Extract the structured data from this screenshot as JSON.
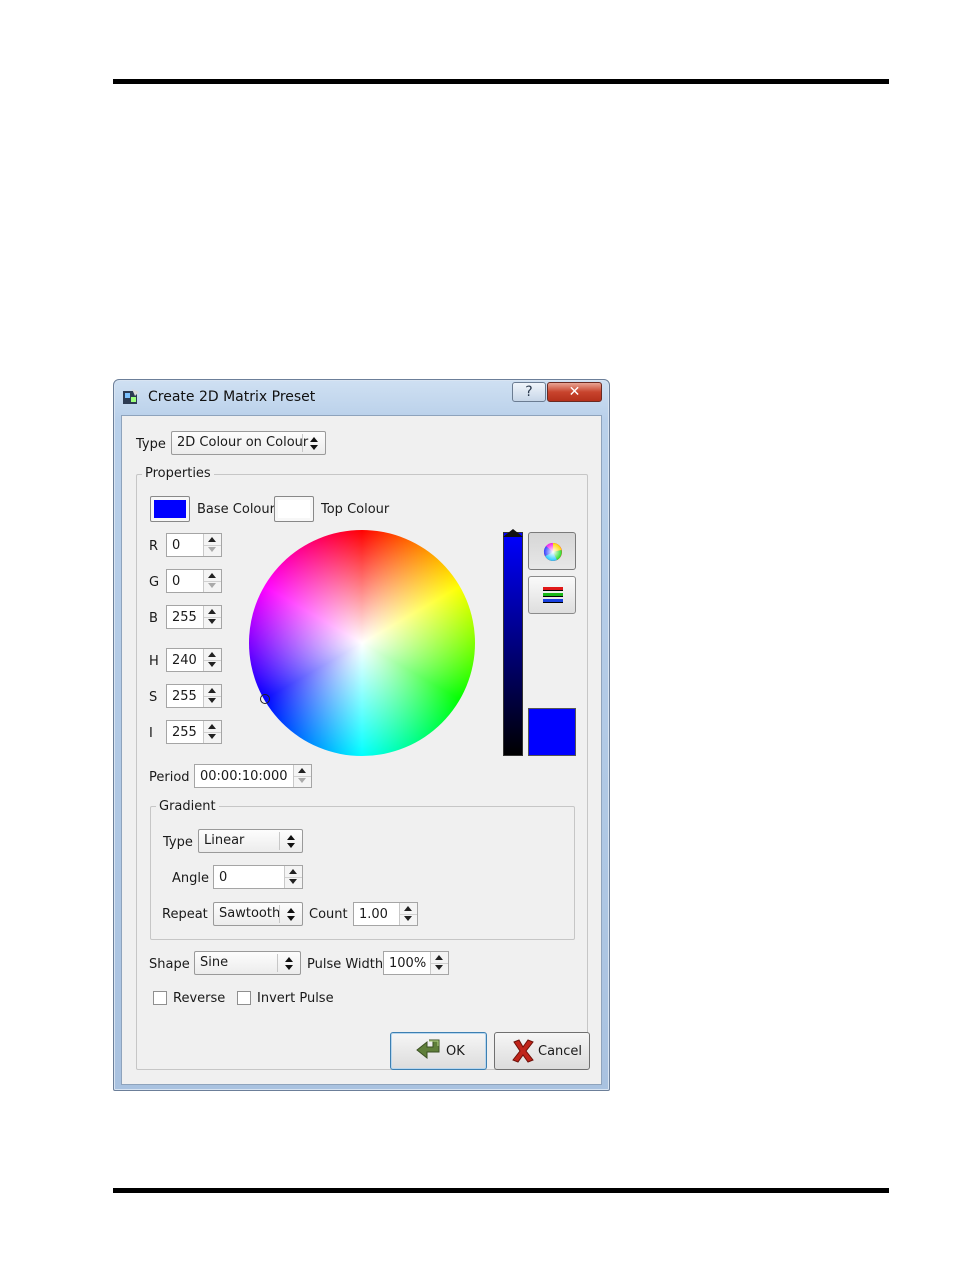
{
  "dialog": {
    "title": "Create 2D Matrix Preset",
    "help_glyph": "?",
    "close_glyph": "✕"
  },
  "type_field": {
    "label": "Type",
    "value": "2D Colour on Colour"
  },
  "properties": {
    "title": "Properties",
    "base_colour_label": "Base Colour",
    "top_colour_label": "Top Colour",
    "base_colour": "#0000ff",
    "top_colour": "#ffffff",
    "fields": {
      "r": {
        "label": "R",
        "value": "0"
      },
      "g": {
        "label": "G",
        "value": "0"
      },
      "b": {
        "label": "B",
        "value": "255"
      },
      "h": {
        "label": "H",
        "value": "240"
      },
      "s": {
        "label": "S",
        "value": "255"
      },
      "i": {
        "label": "I",
        "value": "255"
      }
    },
    "period": {
      "label": "Period",
      "value": "00:00:10:000"
    },
    "gradient": {
      "title": "Gradient",
      "type": {
        "label": "Type",
        "value": "Linear"
      },
      "angle": {
        "label": "Angle",
        "value": "0"
      },
      "repeat": {
        "label": "Repeat",
        "value": "Sawtooth"
      },
      "count": {
        "label": "Count",
        "value": "1.00"
      }
    },
    "shape": {
      "label": "Shape",
      "value": "Sine"
    },
    "pulse_width": {
      "label": "Pulse Width",
      "value": "100%"
    },
    "reverse": {
      "label": "Reverse",
      "checked": false
    },
    "invert_pulse": {
      "label": "Invert Pulse",
      "checked": false
    }
  },
  "buttons": {
    "ok": "OK",
    "cancel": "Cancel"
  },
  "icons": [
    "app-icon",
    "colour-wheel-icon",
    "colour-sliders-icon",
    "ok-arrow-icon",
    "cancel-x-icon"
  ]
}
